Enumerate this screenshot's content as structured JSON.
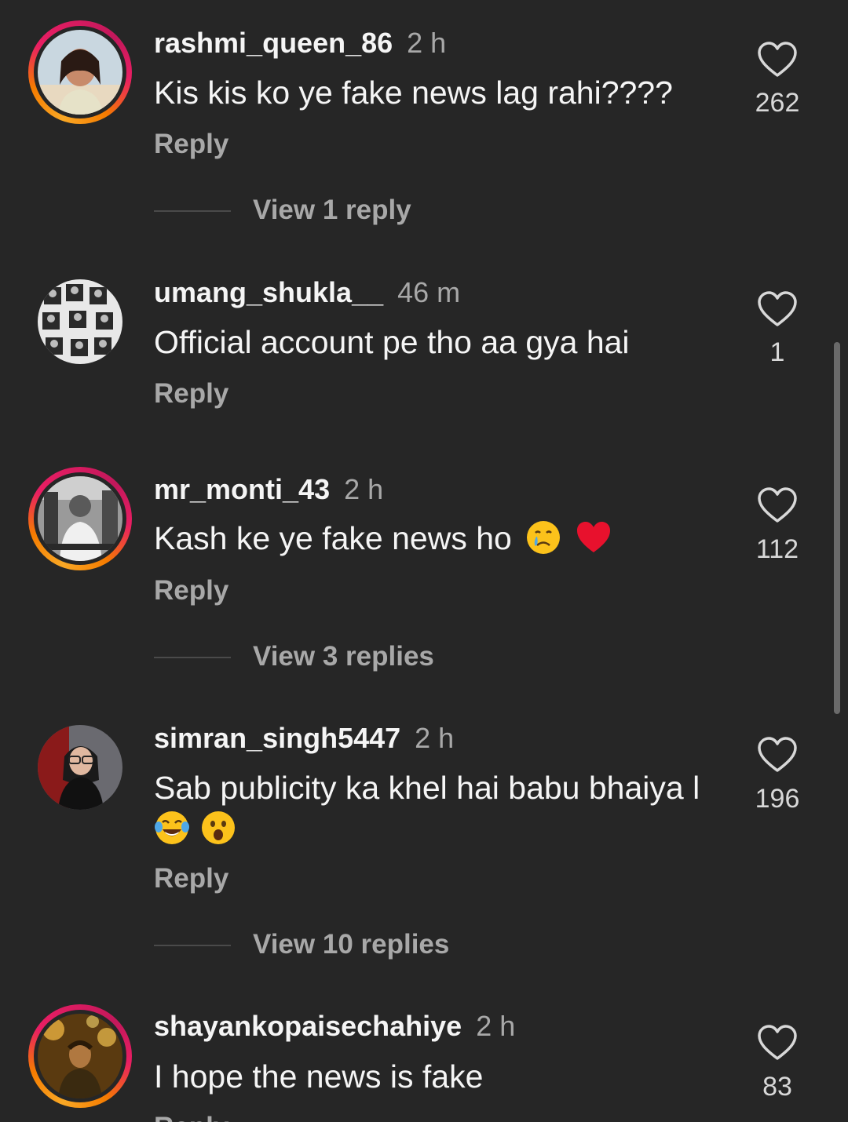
{
  "comments": [
    {
      "username": "rashmi_queen_86",
      "time": "2 h",
      "text": "Kis kis ko ye fake news lag rahi????",
      "reply_label": "Reply",
      "likes": "262",
      "view_replies": "View 1 reply"
    },
    {
      "username": "umang_shukla__",
      "time": "46 m",
      "text": "Official account pe tho aa gya hai",
      "reply_label": "Reply",
      "likes": "1"
    },
    {
      "username": "mr_monti_43",
      "time": "2 h",
      "text": "Kash ke ye fake news ho",
      "emojis": [
        "crying-face",
        "red-heart"
      ],
      "reply_label": "Reply",
      "likes": "112",
      "view_replies": "View 3 replies"
    },
    {
      "username": "simran_singh5447",
      "time": "2 h",
      "text": "Sab publicity ka khel hai babu bhaiya l",
      "emojis": [
        "tears-of-joy-face",
        "astonished-face"
      ],
      "reply_label": "Reply",
      "likes": "196",
      "view_replies": "View 10 replies"
    },
    {
      "username": "shayankopaisechahiye",
      "time": "2 h",
      "text": "I hope the news is fake",
      "reply_label": "Reply",
      "likes": "83"
    }
  ],
  "colors": {
    "background": "#262626",
    "primary_text": "#f5f5f5",
    "secondary_text": "#a8a8a8",
    "story_ring_start": "#f9a825",
    "story_ring_end": "#e91e63"
  }
}
